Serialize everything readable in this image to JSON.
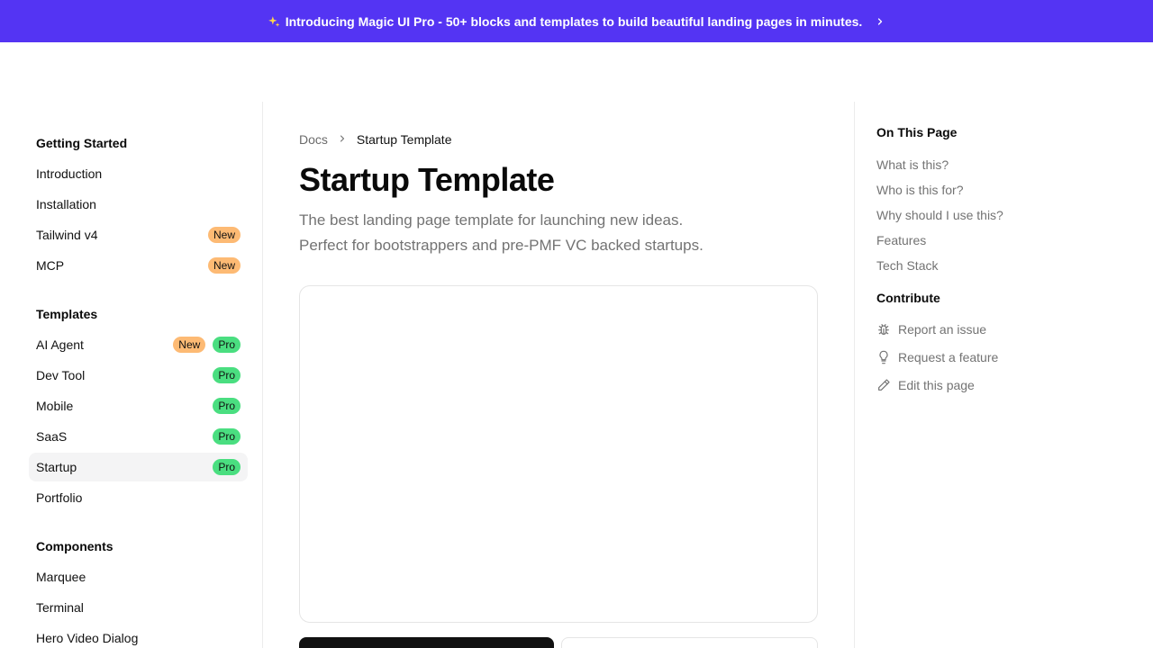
{
  "banner": {
    "text": "Introducing Magic UI Pro - 50+ blocks and templates to build beautiful landing pages in minutes.",
    "icon": "sparkles-icon",
    "chevron": "›"
  },
  "sidebar": {
    "sections": [
      {
        "title": "Getting Started",
        "items": [
          {
            "label": "Introduction",
            "badges": []
          },
          {
            "label": "Installation",
            "badges": []
          },
          {
            "label": "Tailwind v4",
            "badges": [
              "New"
            ]
          },
          {
            "label": "MCP",
            "badges": [
              "New"
            ]
          }
        ]
      },
      {
        "title": "Templates",
        "items": [
          {
            "label": "AI Agent",
            "badges": [
              "New",
              "Pro"
            ]
          },
          {
            "label": "Dev Tool",
            "badges": [
              "Pro"
            ]
          },
          {
            "label": "Mobile",
            "badges": [
              "Pro"
            ]
          },
          {
            "label": "SaaS",
            "badges": [
              "Pro"
            ]
          },
          {
            "label": "Startup",
            "badges": [
              "Pro"
            ],
            "active": true
          },
          {
            "label": "Portfolio",
            "badges": []
          }
        ]
      },
      {
        "title": "Components",
        "items": [
          {
            "label": "Marquee",
            "badges": []
          },
          {
            "label": "Terminal",
            "badges": []
          },
          {
            "label": "Hero Video Dialog",
            "badges": []
          }
        ]
      }
    ]
  },
  "main": {
    "breadcrumb": {
      "root": "Docs",
      "separator": "›",
      "current": "Startup Template"
    },
    "title": "Startup Template",
    "description_line1": "The best landing page template for launching new ideas.",
    "description_line2": "Perfect for bootstrappers and pre-PMF VC backed startups."
  },
  "toc": {
    "heading": "On This Page",
    "links": [
      "What is this?",
      "Who is this for?",
      "Why should I use this?",
      "Features",
      "Tech Stack"
    ],
    "contribute_heading": "Contribute",
    "contribute_links": [
      {
        "label": "Report an issue",
        "icon": "bug-icon"
      },
      {
        "label": "Request a feature",
        "icon": "lightbulb-icon"
      },
      {
        "label": "Edit this page",
        "icon": "pencil-icon"
      }
    ]
  },
  "colors": {
    "banner_bg": "#5434f3",
    "badge_new": "#fdba74",
    "badge_pro": "#4ade80",
    "primary_button": "#111111"
  }
}
